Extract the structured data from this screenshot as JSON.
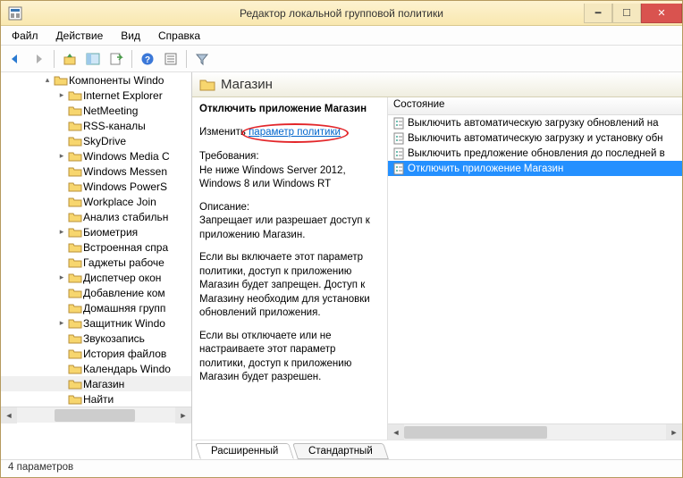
{
  "window": {
    "title": "Редактор локальной групповой политики"
  },
  "menubar": [
    "Файл",
    "Действие",
    "Вид",
    "Справка"
  ],
  "tree": {
    "root": {
      "label": "Компоненты Windo",
      "expanded": true
    },
    "items": [
      {
        "label": "Internet Explorer",
        "exp": true
      },
      {
        "label": "NetMeeting",
        "exp": false
      },
      {
        "label": "RSS-каналы",
        "exp": false
      },
      {
        "label": "SkyDrive",
        "exp": false
      },
      {
        "label": "Windows Media C",
        "exp": true
      },
      {
        "label": "Windows Messen",
        "exp": false
      },
      {
        "label": "Windows PowerS",
        "exp": false
      },
      {
        "label": "Workplace Join",
        "exp": false
      },
      {
        "label": "Анализ стабильн",
        "exp": false
      },
      {
        "label": "Биометрия",
        "exp": true
      },
      {
        "label": "Встроенная спра",
        "exp": false
      },
      {
        "label": "Гаджеты рабоче",
        "exp": false
      },
      {
        "label": "Диспетчер окон",
        "exp": true
      },
      {
        "label": "Добавление ком",
        "exp": false
      },
      {
        "label": "Домашняя групп",
        "exp": false
      },
      {
        "label": "Защитник Windo",
        "exp": true
      },
      {
        "label": "Звукозапись",
        "exp": false
      },
      {
        "label": "История файлов",
        "exp": false
      },
      {
        "label": "Календарь Windo",
        "exp": false
      },
      {
        "label": "Магазин",
        "exp": false,
        "selected": true
      },
      {
        "label": "Найти",
        "exp": false
      }
    ]
  },
  "content": {
    "heading": "Магазин",
    "setting_name": "Отключить приложение Магазин",
    "edit_prefix": "Изменить",
    "edit_link": "параметр политики",
    "req_label": "Требования:",
    "req_text": "Не ниже Windows Server 2012, Windows 8 или Windows RT",
    "desc_label": "Описание:",
    "desc_p1": "Запрещает или разрешает доступ к приложению Магазин.",
    "desc_p2": "Если вы включаете этот параметр политики, доступ к приложению Магазин будет запрещен. Доступ к Магазину необходим для установки обновлений приложения.",
    "desc_p3": "Если вы отключаете или не настраиваете этот параметр политики, доступ к приложению Магазин будет разрешен."
  },
  "list": {
    "col": "Состояние",
    "rows": [
      {
        "label": "Выключить автоматическую загрузку обновлений на"
      },
      {
        "label": "Выключить автоматическую загрузку и установку обн"
      },
      {
        "label": "Выключить предложение обновления до последней в"
      },
      {
        "label": "Отключить приложение Магазин",
        "selected": true
      }
    ]
  },
  "tabs": {
    "extended": "Расширенный",
    "standard": "Стандартный"
  },
  "status": "4 параметров"
}
